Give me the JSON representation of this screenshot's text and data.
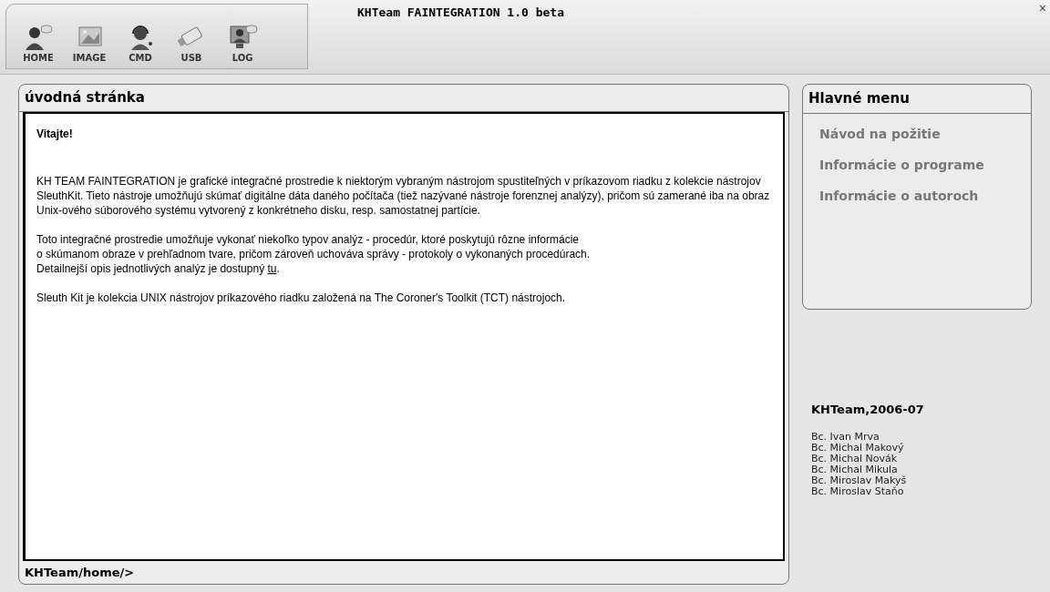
{
  "window": {
    "title": "KHTeam FAINTEGRATION 1.0 beta",
    "close": "×"
  },
  "toolbar": [
    {
      "label": "HOME",
      "kind": "person"
    },
    {
      "label": "IMAGE",
      "kind": "image"
    },
    {
      "label": "CMD",
      "kind": "headset"
    },
    {
      "label": "USB",
      "kind": "usb"
    },
    {
      "label": "LOG",
      "kind": "monitor"
    }
  ],
  "main_panel": {
    "title": "úvodná stránka",
    "heading": "Vitajte!",
    "paragraphs": [
      {
        "text": "KH TEAM FAINTEGRATION je grafické integračné prostredie k niektorým vybraným nástrojom spustiteľných v príkazovom riadku z kolekcie nástrojov SleuthKit. Tieto nástroje umožňujú skúmať digitálne dáta daného počítača (tiež nazývané nástroje forenznej analýzy), pričom sú zamerané iba na obraz Unix-ového súborového systému vytvorený z konkrétneho disku, resp. samostatnej partície."
      },
      {
        "lines": [
          "Toto integračné prostredie umožňuje vykonať niekoľko typov analýz - procedúr, ktoré poskytujú rôzne informácie",
          "o skúmanom obraze v prehľadnom tvare, pričom zároveň uchováva správy - protokoly o vykonaných procedúrach.",
          "Detailnejší opis jednotlivých analýz je dostupný "
        ],
        "link": "tu",
        "after": "."
      },
      {
        "text": "Sleuth Kit je kolekcia UNIX nástrojov príkazového riadku založená na The Coroner's Toolkit (TCT) nástrojoch."
      }
    ],
    "status": "KHTeam/home/>"
  },
  "menu_panel": {
    "title": "Hlavné menu",
    "items": [
      "Návod na požitie",
      "Informácie o programe",
      "Informácie o autoroch"
    ]
  },
  "credits": {
    "title": "KHTeam,2006-07",
    "names": [
      "Bc. Ivan Mrva",
      "Bc. Michal Makový",
      "Bc. Michal Novák",
      "Bc. Michal Mikula",
      "Bc. Miroslav Makyš",
      "Bc. Miroslav Staňo"
    ]
  }
}
